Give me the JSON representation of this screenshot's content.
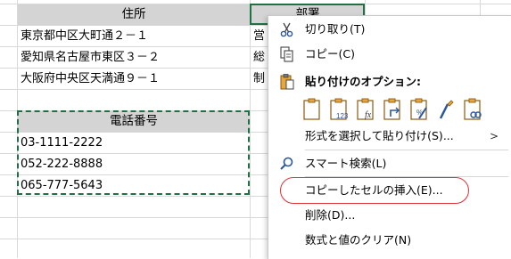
{
  "sheet": {
    "header_address": "住所",
    "header_dept": "部署",
    "addresses": [
      "東京都中区大町通２－１",
      "愛知県名古屋市東区３－２",
      "大阪府中央区天満通９－１"
    ],
    "dept_partial": [
      "営",
      "総",
      "制"
    ],
    "phone_header": "電話番号",
    "phones": [
      "03-1111-2222",
      "052-222-8888",
      "065-777-5643"
    ]
  },
  "context_menu": {
    "items": [
      {
        "label": "切り取り(T)",
        "icon": "scissors-icon"
      },
      {
        "label": "コピー(C)",
        "icon": "copy-icon"
      },
      {
        "label": "貼り付けのオプション:",
        "icon": "paste-clipboard-icon"
      },
      {
        "label": "形式を選択して貼り付け(S)..."
      },
      {
        "label": "スマート検索(L)",
        "icon": "smart-lookup-search-icon"
      },
      {
        "label": "コピーしたセルの挿入(E)..."
      },
      {
        "label": "削除(D)..."
      },
      {
        "label": "数式と値のクリア(N)"
      }
    ],
    "paste_options": [
      "paste-icon",
      "paste-values-123-icon",
      "paste-formulas-fx-icon",
      "paste-transpose-icon",
      "paste-formatting-icon",
      "paste-link-icon"
    ],
    "paste_value_glyph": "123",
    "paste_formula_glyph": "fx",
    "submenu_arrow": ">",
    "highlight_color": "#e0303a",
    "marquee_color": "#1e7145"
  }
}
